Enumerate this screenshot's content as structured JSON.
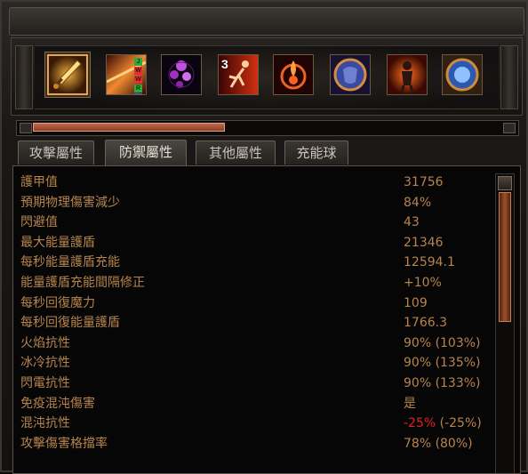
{
  "skills": [
    {
      "name": "sword-skill-icon"
    },
    {
      "name": "linked-gems-skill-icon",
      "gem_letters": [
        "J",
        "W",
        "W",
        "R",
        "B"
      ],
      "gem_colors": [
        "#2faa3a",
        "#e03030",
        "#e03030",
        "#2faa3a",
        "#3a6adf"
      ]
    },
    {
      "name": "purple-orbs-skill-icon"
    },
    {
      "name": "running-man-skill-icon",
      "count": "3"
    },
    {
      "name": "fire-sigil-skill-icon"
    },
    {
      "name": "blue-shield-skill-icon"
    },
    {
      "name": "fire-figure-skill-icon"
    },
    {
      "name": "blue-orb-skill-icon"
    }
  ],
  "progress": 0.4,
  "tabs": [
    "攻擊屬性",
    "防禦屬性",
    "其他屬性",
    "充能球"
  ],
  "active_tab": 1,
  "stats": [
    {
      "label": "護甲值",
      "value": "31756"
    },
    {
      "label": "預期物理傷害減少",
      "value": "84%"
    },
    {
      "label": "閃避值",
      "value": "43"
    },
    {
      "label": "最大能量護盾",
      "value": "21346"
    },
    {
      "label": "每秒能量護盾充能",
      "value": "12594.1"
    },
    {
      "label": "能量護盾充能間隔修正",
      "value": "+10%"
    },
    {
      "label": "每秒回復魔力",
      "value": "109"
    },
    {
      "label": "每秒回復能量護盾",
      "value": "1766.3"
    },
    {
      "label": "火焰抗性",
      "value": "90% (103%)"
    },
    {
      "label": "冰冷抗性",
      "value": "90% (135%)"
    },
    {
      "label": "閃電抗性",
      "value": "90% (133%)"
    },
    {
      "label": "免疫混沌傷害",
      "value": "是"
    },
    {
      "label": "混沌抗性",
      "value_neg": "-25%",
      "value": " (-25%)"
    },
    {
      "label": "攻擊傷害格擋率",
      "value": "78% (80%)"
    }
  ],
  "colors": {
    "stat_text": "#b7844d",
    "negative": "#e02020"
  }
}
